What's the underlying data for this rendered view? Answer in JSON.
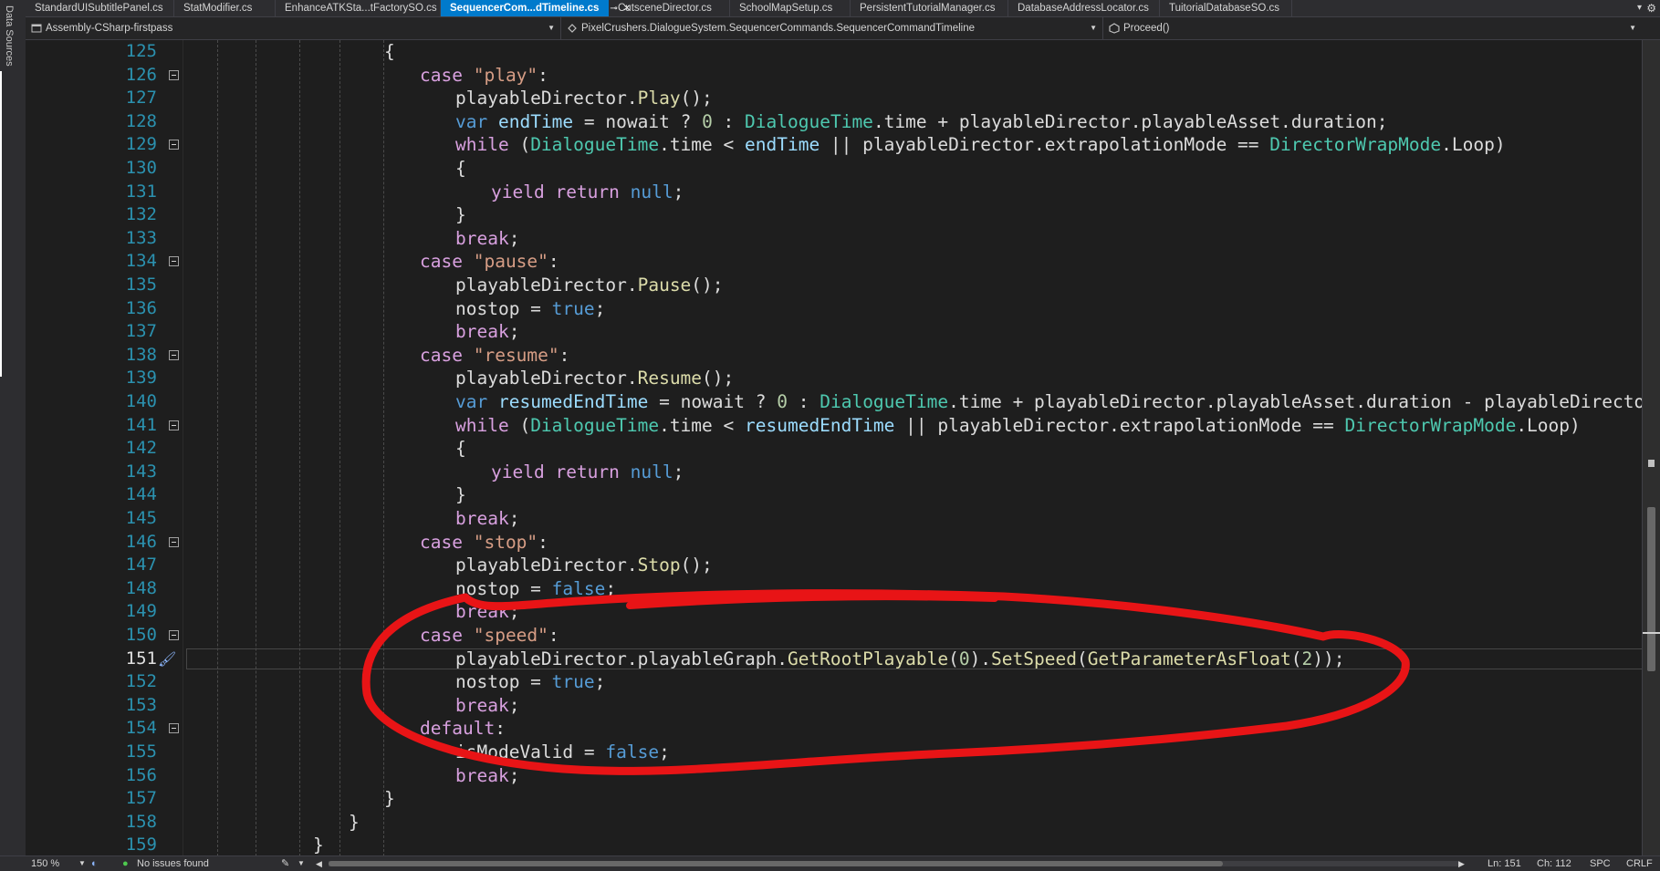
{
  "side_panel": {
    "label": "Data Sources"
  },
  "tabs": [
    {
      "label": "StandardUISubtitlePanel.cs",
      "active": false
    },
    {
      "label": "StatModifier.cs",
      "active": false
    },
    {
      "label": "EnhanceATKSta...tFactorySO.cs",
      "active": false
    },
    {
      "label": "SequencerCom...dTimeline.cs",
      "active": true
    },
    {
      "label": "CutsceneDirector.cs",
      "active": false
    },
    {
      "label": "SchoolMapSetup.cs",
      "active": false
    },
    {
      "label": "PersistentTutorialManager.cs",
      "active": false
    },
    {
      "label": "DatabaseAddressLocator.cs",
      "active": false
    },
    {
      "label": "TuitorialDatabaseSO.cs",
      "active": false
    }
  ],
  "navbar": {
    "project": "Assembly-CSharp-firstpass",
    "type": "PixelCrushers.DialogueSystem.SequencerCommands.SequencerCommandTimeline",
    "member": "Proceed()"
  },
  "editor": {
    "current_line": 151,
    "lines": [
      {
        "n": "125",
        "fold": false,
        "ind": 8,
        "t": [
          [
            "{",
            ""
          ]
        ]
      },
      {
        "n": "126",
        "fold": true,
        "ind": 9,
        "t": [
          [
            "case",
            "ctl"
          ],
          [
            " ",
            ""
          ],
          [
            "\"play\"",
            "str"
          ],
          [
            ":",
            ""
          ]
        ]
      },
      {
        "n": "127",
        "fold": false,
        "ind": 10,
        "t": [
          [
            "playableDirector.",
            ""
          ],
          [
            "Play",
            "mth"
          ],
          [
            "();",
            ""
          ]
        ]
      },
      {
        "n": "128",
        "fold": false,
        "ind": 10,
        "t": [
          [
            "var",
            "kw"
          ],
          [
            " ",
            ""
          ],
          [
            "endTime",
            "loc"
          ],
          [
            " = nowait ? ",
            ""
          ],
          [
            "0",
            "num"
          ],
          [
            " : ",
            ""
          ],
          [
            "DialogueTime",
            "ty"
          ],
          [
            ".time + playableDirector.playableAsset.duration;",
            ""
          ]
        ]
      },
      {
        "n": "129",
        "fold": true,
        "ind": 10,
        "t": [
          [
            "while",
            "ctl"
          ],
          [
            " (",
            ""
          ],
          [
            "DialogueTime",
            "ty"
          ],
          [
            ".time < ",
            ""
          ],
          [
            "endTime",
            "loc"
          ],
          [
            " || playableDirector.extrapolationMode == ",
            ""
          ],
          [
            "DirectorWrapMode",
            "ty"
          ],
          [
            ".Loop)",
            ""
          ]
        ]
      },
      {
        "n": "130",
        "fold": false,
        "ind": 10,
        "t": [
          [
            "{",
            ""
          ]
        ]
      },
      {
        "n": "131",
        "fold": false,
        "ind": 11,
        "t": [
          [
            "yield",
            "ctl"
          ],
          [
            " ",
            ""
          ],
          [
            "return",
            "ctl"
          ],
          [
            " ",
            ""
          ],
          [
            "null",
            "kw"
          ],
          [
            ";",
            ""
          ]
        ]
      },
      {
        "n": "132",
        "fold": false,
        "ind": 10,
        "t": [
          [
            "}",
            ""
          ]
        ]
      },
      {
        "n": "133",
        "fold": false,
        "ind": 10,
        "t": [
          [
            "break",
            "ctl"
          ],
          [
            ";",
            ""
          ]
        ]
      },
      {
        "n": "134",
        "fold": true,
        "ind": 9,
        "t": [
          [
            "case",
            "ctl"
          ],
          [
            " ",
            ""
          ],
          [
            "\"pause\"",
            "str"
          ],
          [
            ":",
            ""
          ]
        ]
      },
      {
        "n": "135",
        "fold": false,
        "ind": 10,
        "t": [
          [
            "playableDirector.",
            ""
          ],
          [
            "Pause",
            "mth"
          ],
          [
            "();",
            ""
          ]
        ]
      },
      {
        "n": "136",
        "fold": false,
        "ind": 10,
        "t": [
          [
            "nostop = ",
            ""
          ],
          [
            "true",
            "kw"
          ],
          [
            ";",
            ""
          ]
        ]
      },
      {
        "n": "137",
        "fold": false,
        "ind": 10,
        "t": [
          [
            "break",
            "ctl"
          ],
          [
            ";",
            ""
          ]
        ]
      },
      {
        "n": "138",
        "fold": true,
        "ind": 9,
        "t": [
          [
            "case",
            "ctl"
          ],
          [
            " ",
            ""
          ],
          [
            "\"resume\"",
            "str"
          ],
          [
            ":",
            ""
          ]
        ]
      },
      {
        "n": "139",
        "fold": false,
        "ind": 10,
        "t": [
          [
            "playableDirector.",
            ""
          ],
          [
            "Resume",
            "mth"
          ],
          [
            "();",
            ""
          ]
        ]
      },
      {
        "n": "140",
        "fold": false,
        "ind": 10,
        "t": [
          [
            "var",
            "kw"
          ],
          [
            " ",
            ""
          ],
          [
            "resumedEndTime",
            "loc"
          ],
          [
            " = nowait ? ",
            ""
          ],
          [
            "0",
            "num"
          ],
          [
            " : ",
            ""
          ],
          [
            "DialogueTime",
            "ty"
          ],
          [
            ".time + playableDirector.playableAsset.duration - playableDirecto",
            ""
          ]
        ]
      },
      {
        "n": "141",
        "fold": true,
        "ind": 10,
        "t": [
          [
            "while",
            "ctl"
          ],
          [
            " (",
            ""
          ],
          [
            "DialogueTime",
            "ty"
          ],
          [
            ".time < ",
            ""
          ],
          [
            "resumedEndTime",
            "loc"
          ],
          [
            " || playableDirector.extrapolationMode == ",
            ""
          ],
          [
            "DirectorWrapMode",
            "ty"
          ],
          [
            ".Loop)",
            ""
          ]
        ]
      },
      {
        "n": "142",
        "fold": false,
        "ind": 10,
        "t": [
          [
            "{",
            ""
          ]
        ]
      },
      {
        "n": "143",
        "fold": false,
        "ind": 11,
        "t": [
          [
            "yield",
            "ctl"
          ],
          [
            " ",
            ""
          ],
          [
            "return",
            "ctl"
          ],
          [
            " ",
            ""
          ],
          [
            "null",
            "kw"
          ],
          [
            ";",
            ""
          ]
        ]
      },
      {
        "n": "144",
        "fold": false,
        "ind": 10,
        "t": [
          [
            "}",
            ""
          ]
        ]
      },
      {
        "n": "145",
        "fold": false,
        "ind": 10,
        "t": [
          [
            "break",
            "ctl"
          ],
          [
            ";",
            ""
          ]
        ]
      },
      {
        "n": "146",
        "fold": true,
        "ind": 9,
        "t": [
          [
            "case",
            "ctl"
          ],
          [
            " ",
            ""
          ],
          [
            "\"stop\"",
            "str"
          ],
          [
            ":",
            ""
          ]
        ]
      },
      {
        "n": "147",
        "fold": false,
        "ind": 10,
        "t": [
          [
            "playableDirector.",
            ""
          ],
          [
            "Stop",
            "mth"
          ],
          [
            "();",
            ""
          ]
        ]
      },
      {
        "n": "148",
        "fold": false,
        "ind": 10,
        "t": [
          [
            "nostop = ",
            ""
          ],
          [
            "false",
            "kw"
          ],
          [
            ";",
            ""
          ]
        ]
      },
      {
        "n": "149",
        "fold": false,
        "ind": 10,
        "t": [
          [
            "break",
            "ctl"
          ],
          [
            ";",
            ""
          ]
        ]
      },
      {
        "n": "150",
        "fold": true,
        "ind": 9,
        "t": [
          [
            "case",
            "ctl"
          ],
          [
            " ",
            ""
          ],
          [
            "\"speed\"",
            "str"
          ],
          [
            ":",
            ""
          ]
        ]
      },
      {
        "n": "151",
        "fold": false,
        "ind": 10,
        "t": [
          [
            "playableDirector.playableGraph.",
            ""
          ],
          [
            "GetRootPlayable",
            "mth"
          ],
          [
            "(",
            ""
          ],
          [
            "0",
            "num"
          ],
          [
            ").",
            ""
          ],
          [
            "SetSpeed",
            "mth"
          ],
          [
            "(",
            ""
          ],
          [
            "GetParameterAsFloat",
            "mth"
          ],
          [
            "(",
            ""
          ],
          [
            "2",
            "num"
          ],
          [
            "));",
            ""
          ]
        ]
      },
      {
        "n": "152",
        "fold": false,
        "ind": 10,
        "t": [
          [
            "nostop = ",
            ""
          ],
          [
            "true",
            "kw"
          ],
          [
            ";",
            ""
          ]
        ]
      },
      {
        "n": "153",
        "fold": false,
        "ind": 10,
        "t": [
          [
            "break",
            "ctl"
          ],
          [
            ";",
            ""
          ]
        ]
      },
      {
        "n": "154",
        "fold": true,
        "ind": 9,
        "t": [
          [
            "default",
            "ctl"
          ],
          [
            ":",
            ""
          ]
        ]
      },
      {
        "n": "155",
        "fold": false,
        "ind": 10,
        "t": [
          [
            "isModeValid = ",
            ""
          ],
          [
            "false",
            "kw"
          ],
          [
            ";",
            ""
          ]
        ]
      },
      {
        "n": "156",
        "fold": false,
        "ind": 10,
        "t": [
          [
            "break",
            "ctl"
          ],
          [
            ";",
            ""
          ]
        ]
      },
      {
        "n": "157",
        "fold": false,
        "ind": 8,
        "t": [
          [
            "}",
            ""
          ]
        ]
      },
      {
        "n": "158",
        "fold": false,
        "ind": 7,
        "t": [
          [
            "}",
            ""
          ]
        ]
      },
      {
        "n": "159",
        "fold": false,
        "ind": 6,
        "t": [
          [
            "}",
            ""
          ]
        ]
      }
    ]
  },
  "status": {
    "zoom": "150 %",
    "issues": "No issues found",
    "line": "Ln: 151",
    "char": "Ch: 112",
    "whitespace": "SPC",
    "line_ending": "CRLF"
  },
  "colors": {
    "accent": "#007acc",
    "annotation": "#e81416",
    "keyword": "#569cd6",
    "control": "#d8a0df",
    "string": "#d69d85",
    "type": "#4ec9b0",
    "method": "#dcdcaa",
    "local": "#9cdcfe",
    "number": "#b5cea8"
  }
}
